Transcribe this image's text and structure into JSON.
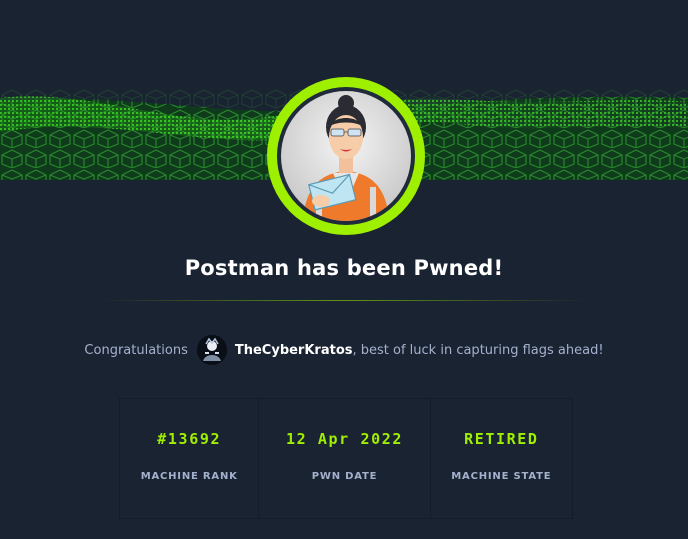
{
  "title": "Postman has been Pwned!",
  "congrats": {
    "prefix": "Congratulations",
    "username": "TheCyberKratos",
    "suffix": ", best of luck in capturing flags ahead!"
  },
  "stats": [
    {
      "value": "#13692",
      "label": "MACHINE RANK"
    },
    {
      "value": "12 Apr 2022",
      "label": "PWN DATE"
    },
    {
      "value": "RETIRED",
      "label": "MACHINE STATE"
    }
  ],
  "colors": {
    "accent": "#9fef00",
    "background": "#1a2332",
    "muted": "#a4b1cd"
  },
  "icons": {
    "machine_avatar": "postman-woman-avatar",
    "user_avatar": "user-avatar",
    "banner": "green-cube-wave"
  }
}
